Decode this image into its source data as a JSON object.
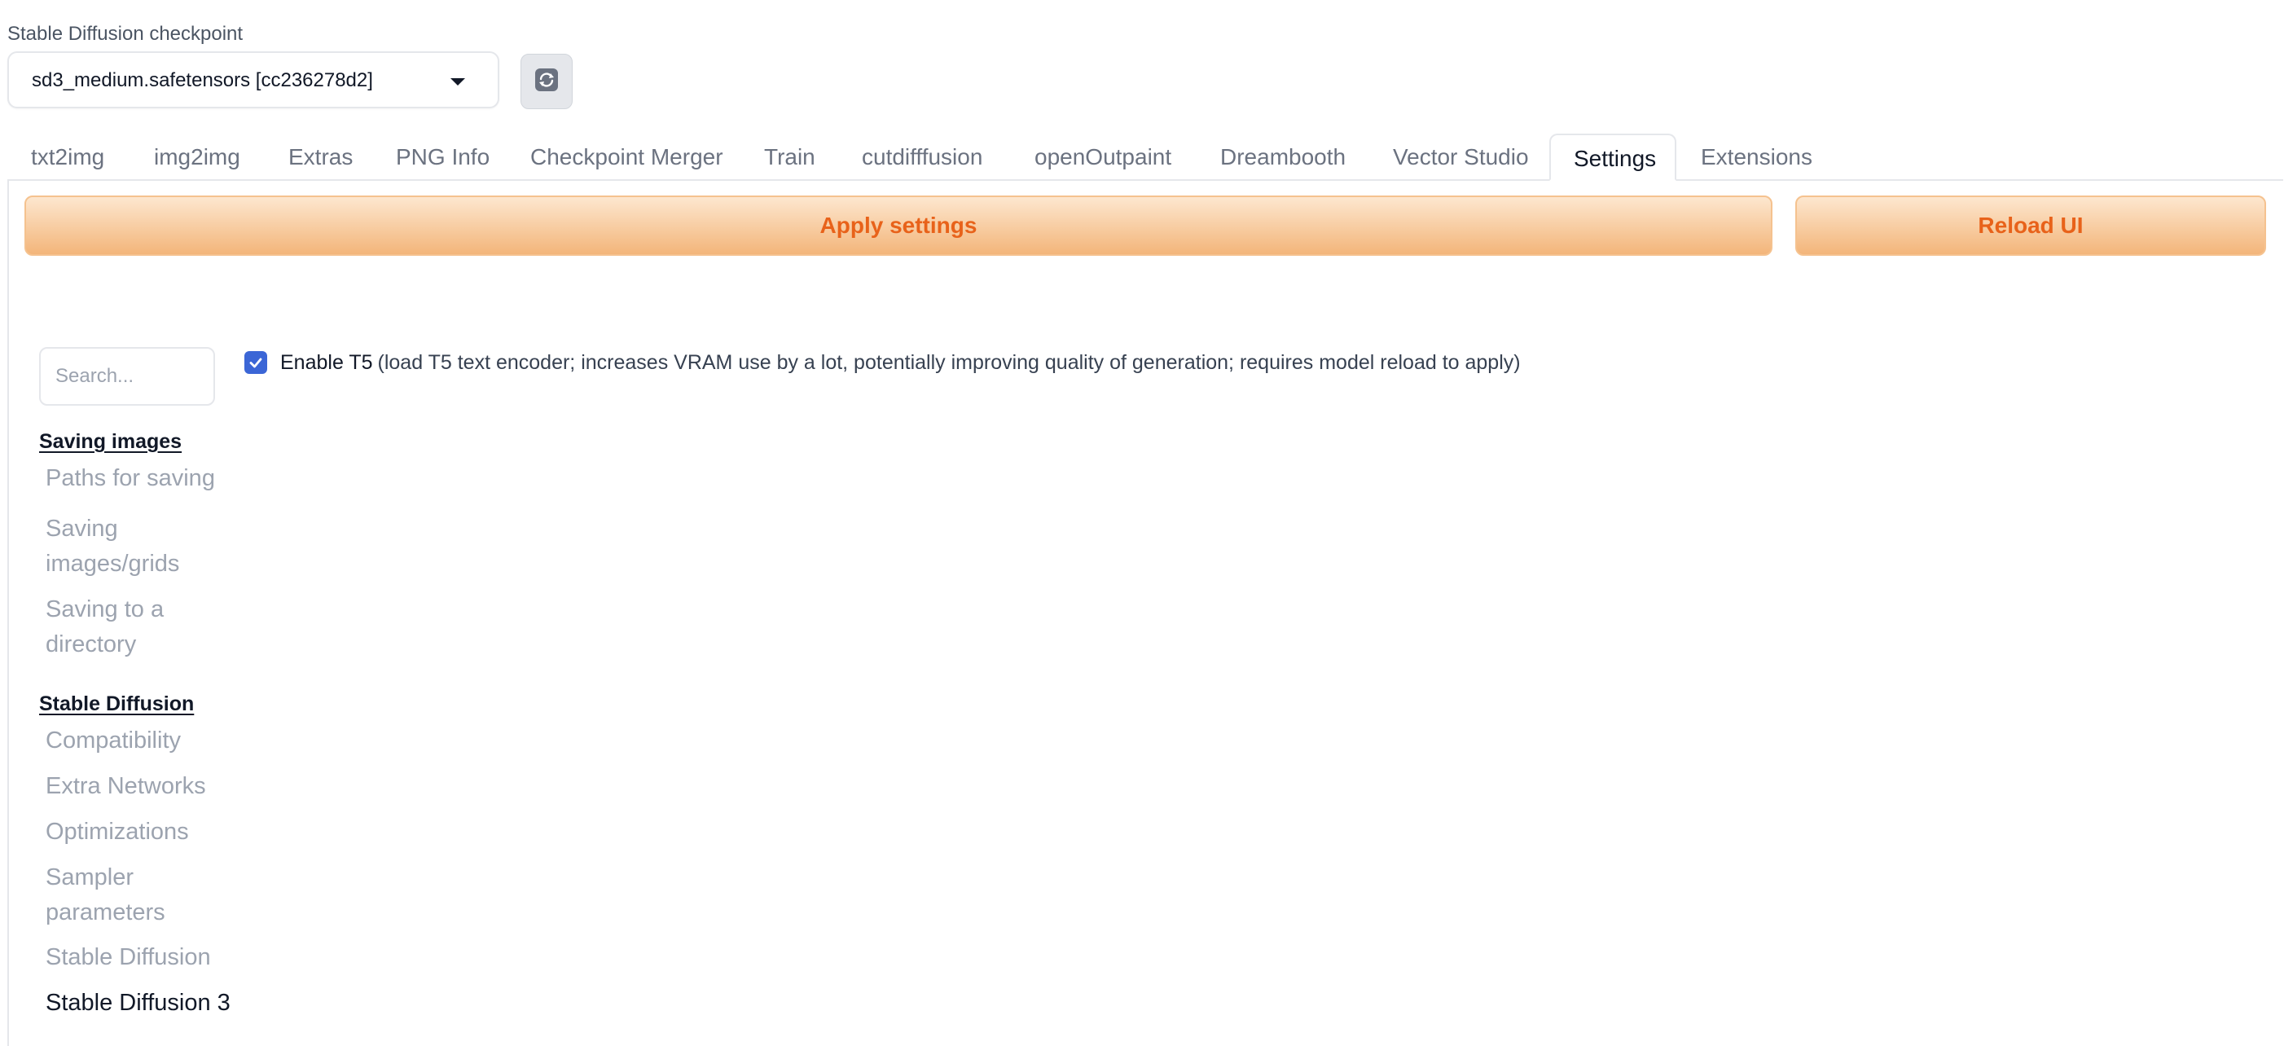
{
  "checkpoint": {
    "label": "Stable Diffusion checkpoint",
    "value": "sd3_medium.safetensors [cc236278d2]"
  },
  "tabs": [
    {
      "label": "txt2img"
    },
    {
      "label": "img2img"
    },
    {
      "label": "Extras"
    },
    {
      "label": "PNG Info"
    },
    {
      "label": "Checkpoint Merger"
    },
    {
      "label": "Train"
    },
    {
      "label": "cutdifffusion"
    },
    {
      "label": "openOutpaint"
    },
    {
      "label": "Dreambooth"
    },
    {
      "label": "Vector Studio"
    },
    {
      "label": "Settings"
    },
    {
      "label": "Extensions"
    }
  ],
  "actions": {
    "apply": "Apply settings",
    "reload": "Reload UI"
  },
  "search": {
    "placeholder": "Search..."
  },
  "sidebar": {
    "sections": [
      {
        "header": "Saving images",
        "items": [
          "Paths for saving",
          "Saving images/grids",
          "Saving to a directory"
        ]
      },
      {
        "header": "Stable Diffusion",
        "items": [
          "Compatibility",
          "Extra Networks",
          "Optimizations",
          "Sampler parameters",
          "Stable Diffusion",
          "Stable Diffusion 3"
        ]
      }
    ]
  },
  "setting": {
    "checked": true,
    "label": "Enable T5",
    "description": "(load T5 text encoder; increases VRAM use by a lot, potentially improving quality of generation; requires model reload to apply)"
  },
  "colors": {
    "accent": "#e8621a",
    "checkbox": "#3b66d6"
  }
}
